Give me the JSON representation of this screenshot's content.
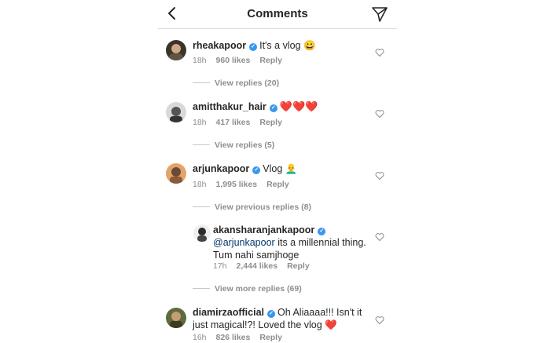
{
  "header": {
    "title": "Comments",
    "back_icon": "chevron-left-icon",
    "direct_icon": "paper-plane-icon"
  },
  "comments": [
    {
      "username": "rheakapoor",
      "text": "It's a vlog 😀",
      "time": "18h",
      "likes": "960 likes",
      "reply": "Reply",
      "view_replies": "View replies (20)"
    },
    {
      "username": "amitthakur_hair",
      "text": "❤️❤️❤️",
      "time": "18h",
      "likes": "417 likes",
      "reply": "Reply",
      "view_replies": "View replies (5)"
    },
    {
      "username": "arjunkapoor",
      "text": "Vlog 👨‍🦲",
      "time": "18h",
      "likes": "1,995 likes",
      "reply": "Reply",
      "view_replies": "View previous replies (8)"
    },
    {
      "username": "diamirzaofficial",
      "text_line1": "Oh Aliaaaa!!! Isn't it",
      "text_line2": "just magical!?! Loved the vlog ❤️",
      "time": "16h",
      "likes": "826 likes",
      "reply": "Reply"
    }
  ],
  "nested_reply": {
    "username": "akansharanjankapoor",
    "mention": "@arjunkapoor",
    "text_line1_rest": " its a millennial thing.",
    "text_line2": "Tum nahi samjhoge",
    "time": "17h",
    "likes": "2,444 likes",
    "reply": "Reply",
    "view_more": "View more replies (69)"
  },
  "colors": {
    "verified": "#3897f0",
    "meta": "#8e8e8e",
    "text": "#262626",
    "heart": "#ed1c24"
  }
}
